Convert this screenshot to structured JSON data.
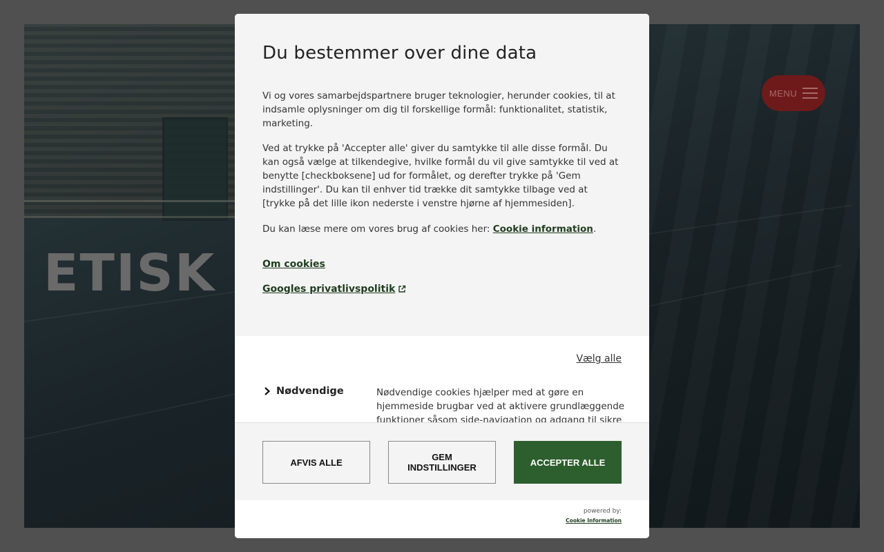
{
  "background": {
    "hero_title": "ETISK K",
    "menu": {
      "label": "MENU"
    }
  },
  "dialog": {
    "title": "Du bestemmer over dine data",
    "paragraph1": "Vi og vores samarbejdspartnere bruger teknologier, herunder cookies, til at indsamle oplysninger om dig til forskellige formål: funktionalitet, statistik, marketing.",
    "paragraph2": "Ved at trykke på 'Accepter alle' giver du samtykke til alle disse formål. Du kan også vælge at tilkendegive, hvilke formål du vil give samtykke til ved at benytte [checkboksene] ud for formålet, og derefter trykke på 'Gem indstillinger'. Du kan til enhver tid trække dit samtykke tilbage ved at [trykke på det lille ikon nederste i venstre hjørne af hjemmesiden].",
    "paragraph3_prefix": "Du kan læse mere om vores brug af cookies her: ",
    "paragraph3_link": "Cookie information",
    "paragraph3_suffix": ".",
    "om_cookies_link": "Om cookies",
    "google_privacy_link": "Googles privatlivspolitik",
    "select_all": "Vælg alle",
    "categories": [
      {
        "label": "Nødvendige",
        "description": "Nødvendige cookies hjælper med at gøre en hjemmeside brugbar ved at aktivere grundlæggende funktioner såsom side-navigation og adgang til sikre"
      }
    ],
    "buttons": {
      "reject_all": "AFVIS ALLE",
      "save_settings": "GEM INDSTILLINGER",
      "accept_all": "ACCEPTER ALLE"
    },
    "footer": {
      "powered_by": "powered by:",
      "brand_link": "Cookie Information"
    }
  },
  "colors": {
    "accept_green": "#2d5e2d",
    "link_green": "#1f3d1f",
    "menu_red": "#6e1a1a"
  }
}
